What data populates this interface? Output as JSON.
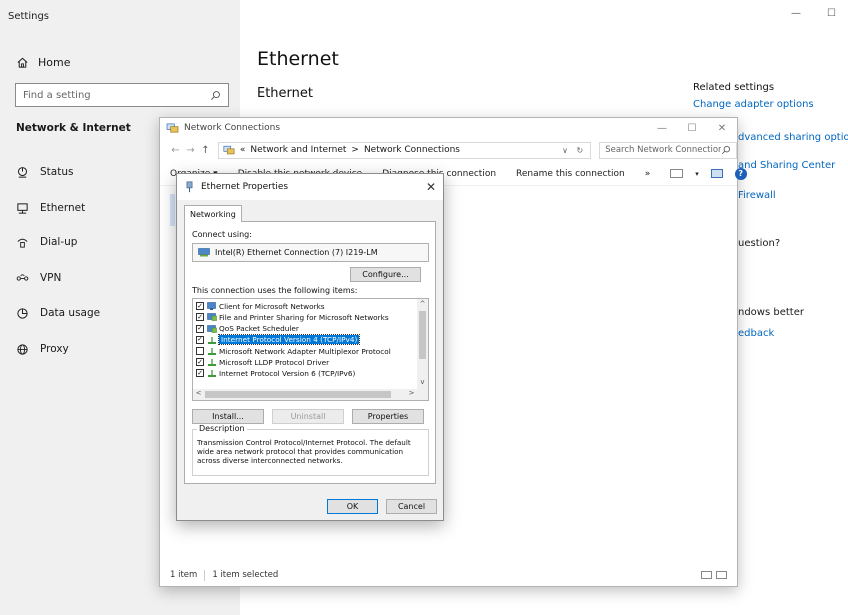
{
  "settings": {
    "app_title": "Settings",
    "home_label": "Home",
    "search_placeholder": "Find a setting",
    "section_header": "Network & Internet",
    "nav": [
      {
        "label": "Status",
        "icon": "status-icon"
      },
      {
        "label": "Ethernet",
        "icon": "ethernet-icon"
      },
      {
        "label": "Dial-up",
        "icon": "dialup-icon"
      },
      {
        "label": "VPN",
        "icon": "vpn-icon"
      },
      {
        "label": "Data usage",
        "icon": "data-usage-icon"
      },
      {
        "label": "Proxy",
        "icon": "proxy-icon"
      }
    ],
    "page_title": "Ethernet",
    "page_subtitle": "Ethernet",
    "related_title": "Related settings",
    "related_links": {
      "change_adapter": "Change adapter options",
      "sharing_options": "dvanced sharing options",
      "sharing_center": "and Sharing Center",
      "firewall": "Firewall"
    },
    "partial_question": "uestion?",
    "partial_windows_better": "ndows better",
    "partial_feedback": "edback"
  },
  "network_connections": {
    "title": "Network Connections",
    "breadcrumb": {
      "prefix": "«",
      "part1": "Network and Internet",
      "separator": ">",
      "part2": "Network Connections"
    },
    "search_placeholder": "Search Network Connections",
    "toolbar": {
      "organize": "Organize ▾",
      "disable": "Disable this network device",
      "diagnose": "Diagnose this connection",
      "rename": "Rename this connection",
      "more": "»"
    },
    "status": {
      "items": "1 item",
      "selected": "1 item selected"
    }
  },
  "dialog": {
    "title": "Ethernet Properties",
    "close": "✕",
    "tab": "Networking",
    "connect_using_label": "Connect using:",
    "adapter_name": "Intel(R) Ethernet Connection (7) I219-LM",
    "configure_button": "Configure...",
    "items_label": "This connection uses the following items:",
    "items": [
      {
        "label": "Client for Microsoft Networks",
        "checked": true,
        "selected": false,
        "icon": "network-client-icon"
      },
      {
        "label": "File and Printer Sharing for Microsoft Networks",
        "checked": true,
        "selected": false,
        "icon": "network-service-icon"
      },
      {
        "label": "QoS Packet Scheduler",
        "checked": true,
        "selected": false,
        "icon": "network-service-icon"
      },
      {
        "label": "Internet Protocol Version 4 (TCP/IPv4)",
        "checked": true,
        "selected": true,
        "icon": "protocol-icon"
      },
      {
        "label": "Microsoft Network Adapter Multiplexor Protocol",
        "checked": false,
        "selected": false,
        "icon": "protocol-icon"
      },
      {
        "label": "Microsoft LLDP Protocol Driver",
        "checked": true,
        "selected": false,
        "icon": "protocol-icon"
      },
      {
        "label": "Internet Protocol Version 6 (TCP/IPv6)",
        "checked": true,
        "selected": false,
        "icon": "protocol-icon"
      }
    ],
    "install_button": "Install...",
    "uninstall_button": "Uninstall",
    "properties_button": "Properties",
    "description_title": "Description",
    "description_text": "Transmission Control Protocol/Internet Protocol. The default wide area network protocol that provides communication across diverse interconnected networks.",
    "ok_button": "OK",
    "cancel_button": "Cancel"
  },
  "colors": {
    "link": "#0067c0",
    "selection": "#0078d7",
    "sidebar_bg": "#f0f0f0"
  }
}
